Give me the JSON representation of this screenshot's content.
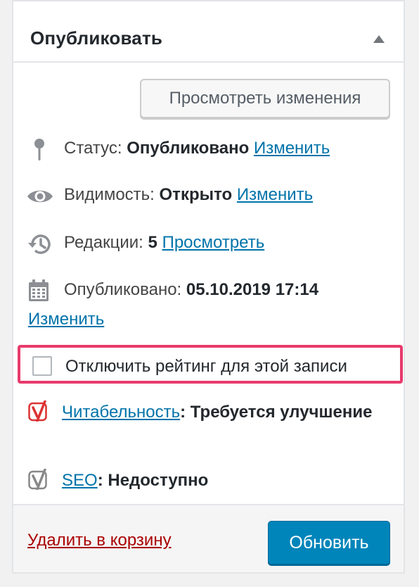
{
  "header": {
    "title": "Опубликовать"
  },
  "actions": {
    "preview_label": "Просмотреть изменения"
  },
  "status": {
    "label": "Статус:",
    "value": "Опубликовано",
    "link": "Изменить",
    "icon": "pin-icon"
  },
  "visibility": {
    "label": "Видимость:",
    "value": "Открыто",
    "link": "Изменить",
    "icon": "eye-icon"
  },
  "revisions": {
    "label": "Редакции:",
    "value": "5",
    "link": "Просмотреть",
    "icon": "history-icon"
  },
  "published": {
    "label": "Опубликовано:",
    "value": "05.10.2019 17:14",
    "link": "Изменить",
    "icon": "calendar-icon"
  },
  "rating": {
    "checkbox_label": "Отключить рейтинг для этой записи",
    "checked": false
  },
  "yoast": {
    "readability": {
      "link": "Читабельность",
      "sep": ":",
      "value": "Требуется улучшение",
      "color": "#dc3232"
    },
    "seo": {
      "link": "SEO",
      "sep": ":",
      "value": "Недоступно",
      "color": "#888888"
    }
  },
  "footer": {
    "trash_label": "Удалить в корзину",
    "update_label": "Обновить"
  },
  "colors": {
    "link": "#0073aa",
    "primary": "#0085ba",
    "delete": "#aa0000",
    "highlight": "#e83a6b"
  }
}
